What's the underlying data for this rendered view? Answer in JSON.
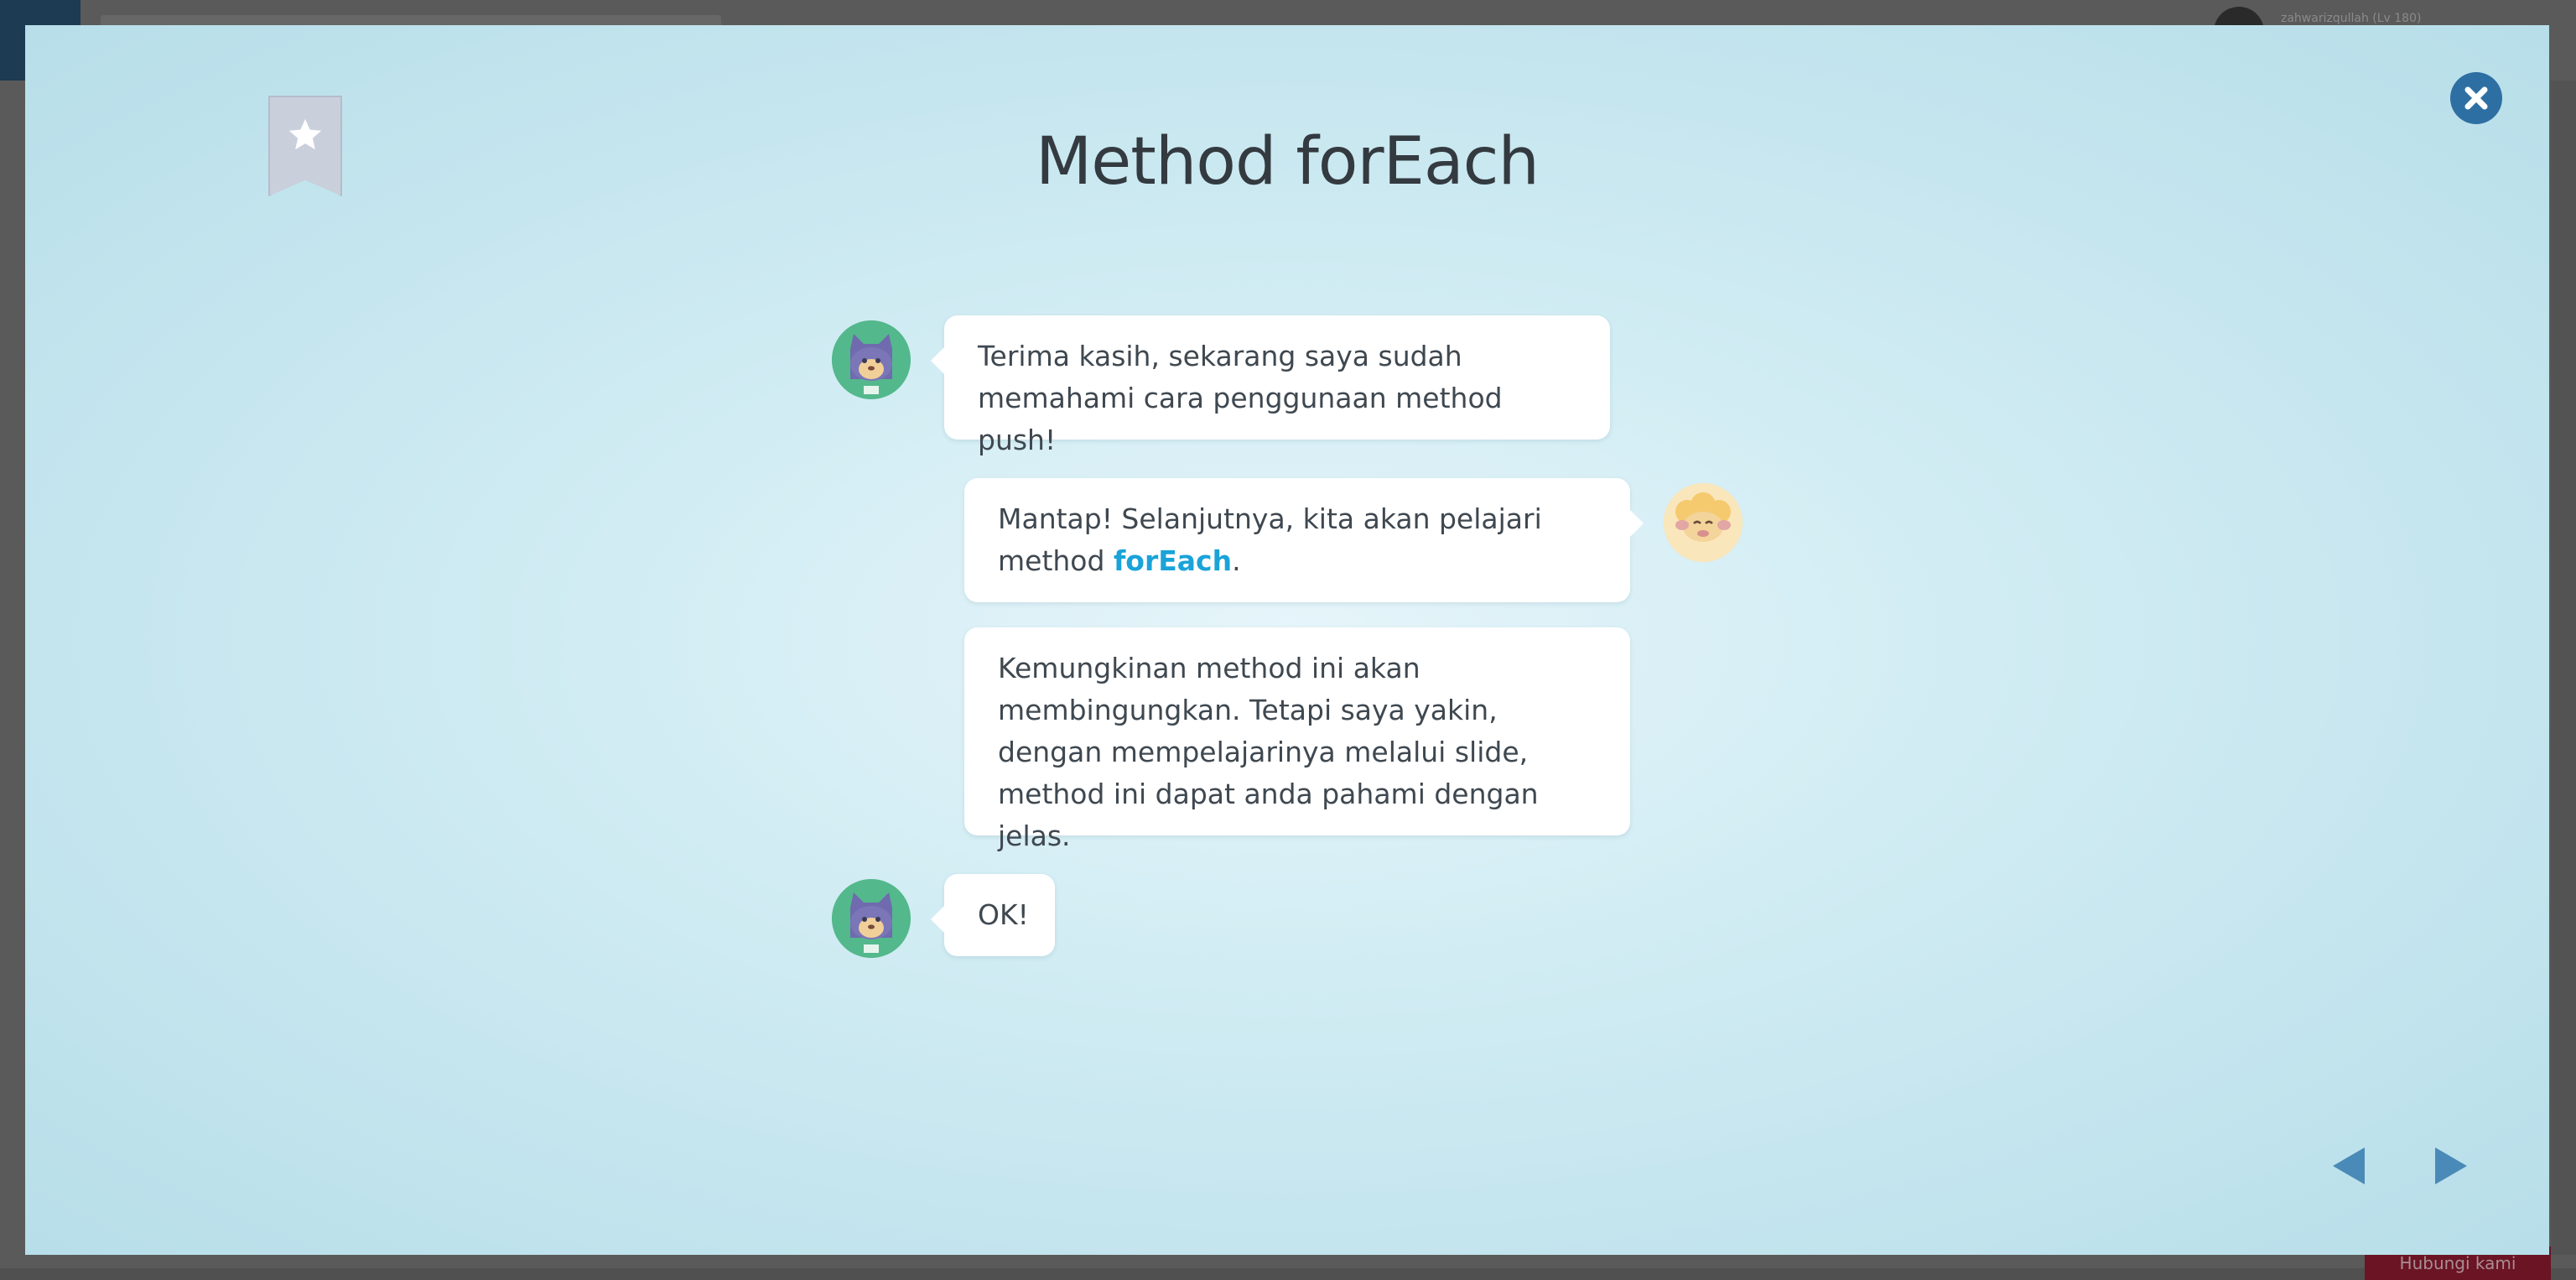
{
  "background": {
    "username": "zahwarizqullah (Lv 180)",
    "help_label": "Hubungi kami"
  },
  "modal": {
    "title": "Method forEach",
    "messages": [
      {
        "speaker": "cat",
        "text": "Terima kasih, sekarang saya sudah memahami cara penggunaan method push!"
      },
      {
        "speaker": "sheep",
        "text_before": "Mantap! Selanjutnya, kita akan pelajari method ",
        "highlight": "forEach",
        "text_after": "."
      },
      {
        "speaker": "sheep",
        "text": "Kemungkinan method ini akan membingungkan. Tetapi saya yakin, dengan mempelajarinya melalui slide, method ini dapat anda pahami dengan jelas."
      },
      {
        "speaker": "cat",
        "text": "OK!"
      }
    ]
  },
  "icons": {
    "bookmark": "bookmark-star-icon",
    "close": "close-icon",
    "prev": "arrow-left-icon",
    "next": "arrow-right-icon"
  },
  "colors": {
    "accent": "#1aa3d9",
    "close_button": "#2e6fa3",
    "nav_arrow": "#4a8ab8",
    "cat_avatar": "#53b88c",
    "sheep_avatar": "#f7d68c"
  }
}
